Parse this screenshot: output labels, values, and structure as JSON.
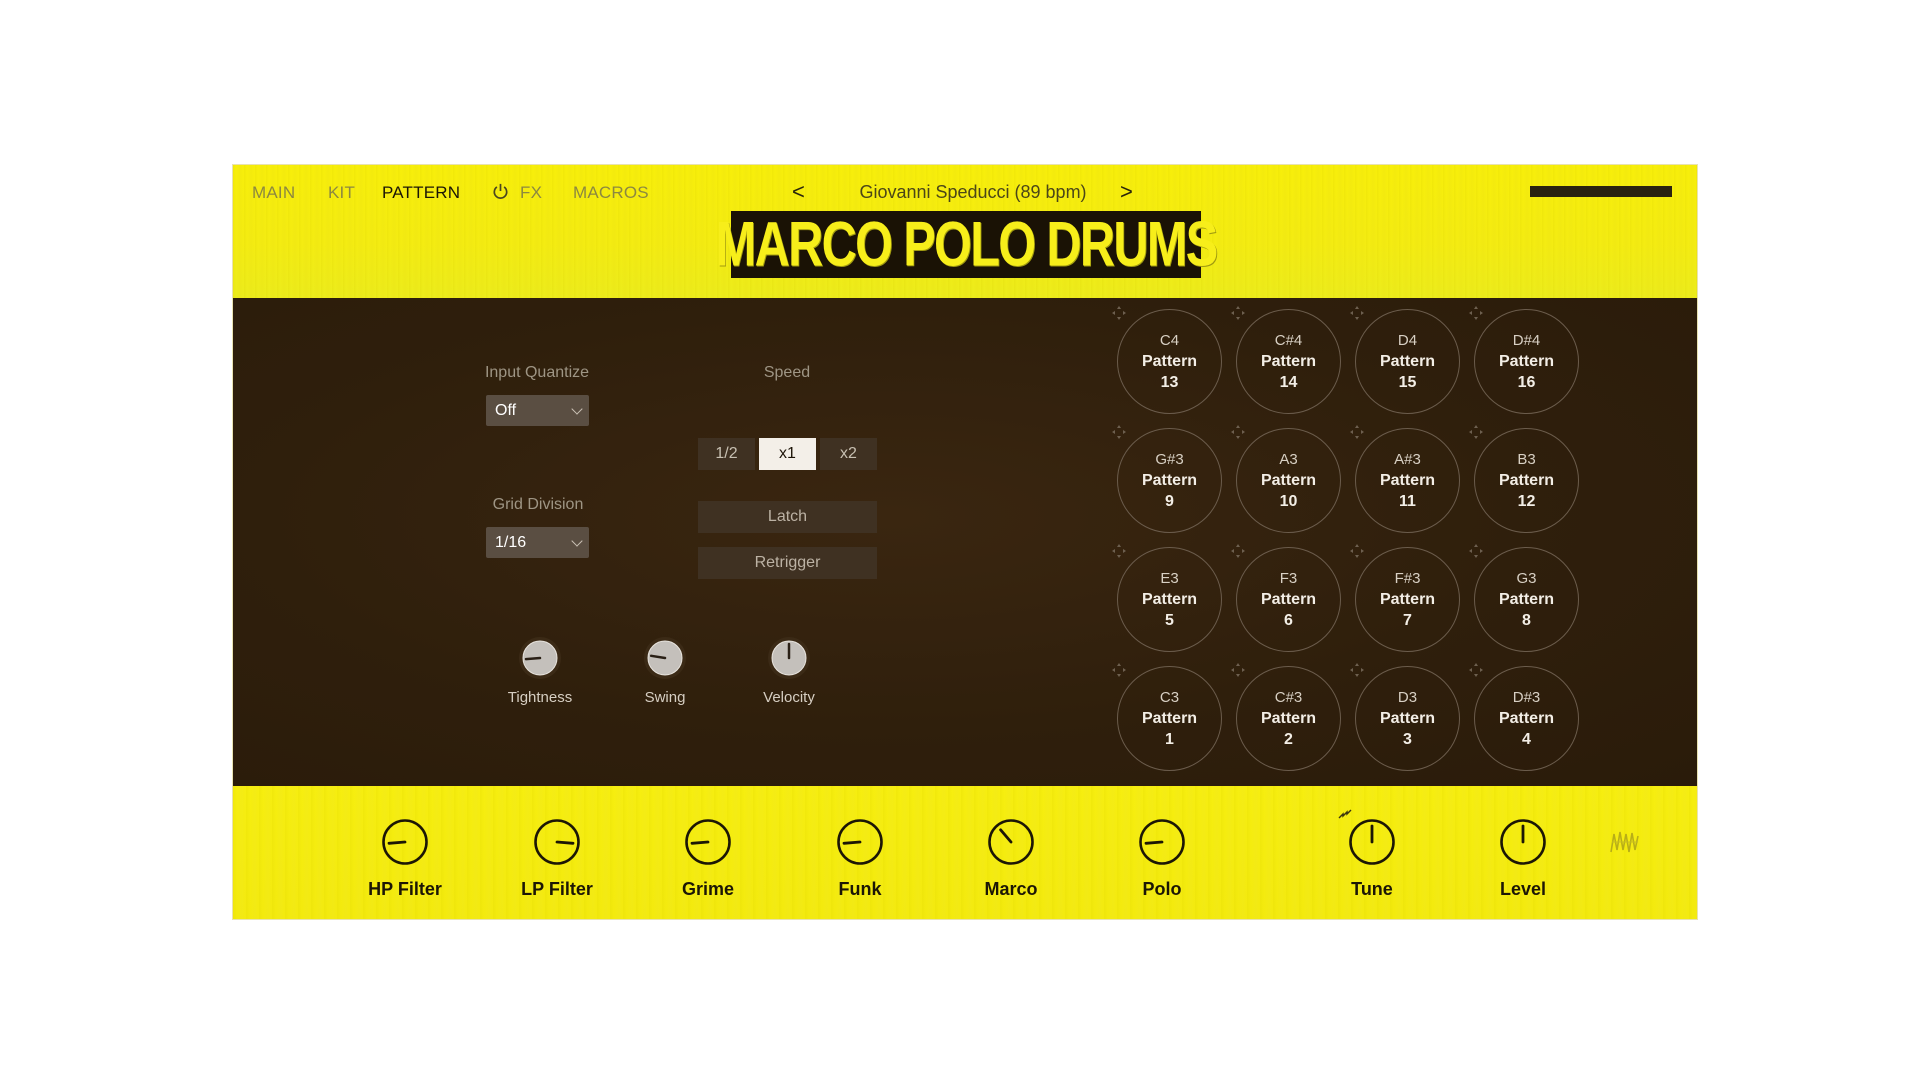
{
  "nav": {
    "tabs": [
      {
        "label": "MAIN"
      },
      {
        "label": "KIT"
      },
      {
        "label": "PATTERN"
      },
      {
        "label": "FX"
      },
      {
        "label": "MACROS"
      }
    ],
    "active_tab": "PATTERN"
  },
  "preset": {
    "name": "Giovanni Speducci (89 bpm)",
    "prev": "<",
    "next": ">"
  },
  "logo": {
    "text": "MARCO POLO DRUMS"
  },
  "controls": {
    "input_quantize": {
      "label": "Input Quantize",
      "value": "Off"
    },
    "grid_division": {
      "label": "Grid Division",
      "value": "1/16"
    },
    "speed": {
      "label": "Speed",
      "options": [
        "1/2",
        "x1",
        "x2"
      ],
      "selected": "x1"
    },
    "latch": "Latch",
    "retrigger": "Retrigger",
    "knobs": [
      {
        "label": "Tightness",
        "value": 0.15
      },
      {
        "label": "Swing",
        "value": 0.2
      },
      {
        "label": "Velocity",
        "value": 0.5
      }
    ]
  },
  "pads": [
    {
      "note": "C4",
      "name": "Pattern",
      "number": "13"
    },
    {
      "note": "C#4",
      "name": "Pattern",
      "number": "14"
    },
    {
      "note": "D4",
      "name": "Pattern",
      "number": "15"
    },
    {
      "note": "D#4",
      "name": "Pattern",
      "number": "16"
    },
    {
      "note": "G#3",
      "name": "Pattern",
      "number": "9"
    },
    {
      "note": "A3",
      "name": "Pattern",
      "number": "10"
    },
    {
      "note": "A#3",
      "name": "Pattern",
      "number": "11"
    },
    {
      "note": "B3",
      "name": "Pattern",
      "number": "12"
    },
    {
      "note": "E3",
      "name": "Pattern",
      "number": "5"
    },
    {
      "note": "F3",
      "name": "Pattern",
      "number": "6"
    },
    {
      "note": "F#3",
      "name": "Pattern",
      "number": "7"
    },
    {
      "note": "G3",
      "name": "Pattern",
      "number": "8"
    },
    {
      "note": "C3",
      "name": "Pattern",
      "number": "1"
    },
    {
      "note": "C#3",
      "name": "Pattern",
      "number": "2"
    },
    {
      "note": "D3",
      "name": "Pattern",
      "number": "3"
    },
    {
      "note": "D#3",
      "name": "Pattern",
      "number": "4"
    }
  ],
  "macros": [
    {
      "label": "HP Filter",
      "value": 0.15
    },
    {
      "label": "LP Filter",
      "value": 0.85
    },
    {
      "label": "Grime",
      "value": 0.15
    },
    {
      "label": "Funk",
      "value": 0.15
    },
    {
      "label": "Marco",
      "value": 0.35
    },
    {
      "label": "Polo",
      "value": 0.15
    },
    {
      "label": "Tune",
      "value": 0.5
    },
    {
      "label": "Level",
      "value": 0.5
    }
  ],
  "colors": {
    "accent_yellow": "#f6ee0f",
    "panel_brown": "#2f1f0c",
    "button_brown": "#3f3122",
    "dropdown_grey": "#5a4e42"
  }
}
